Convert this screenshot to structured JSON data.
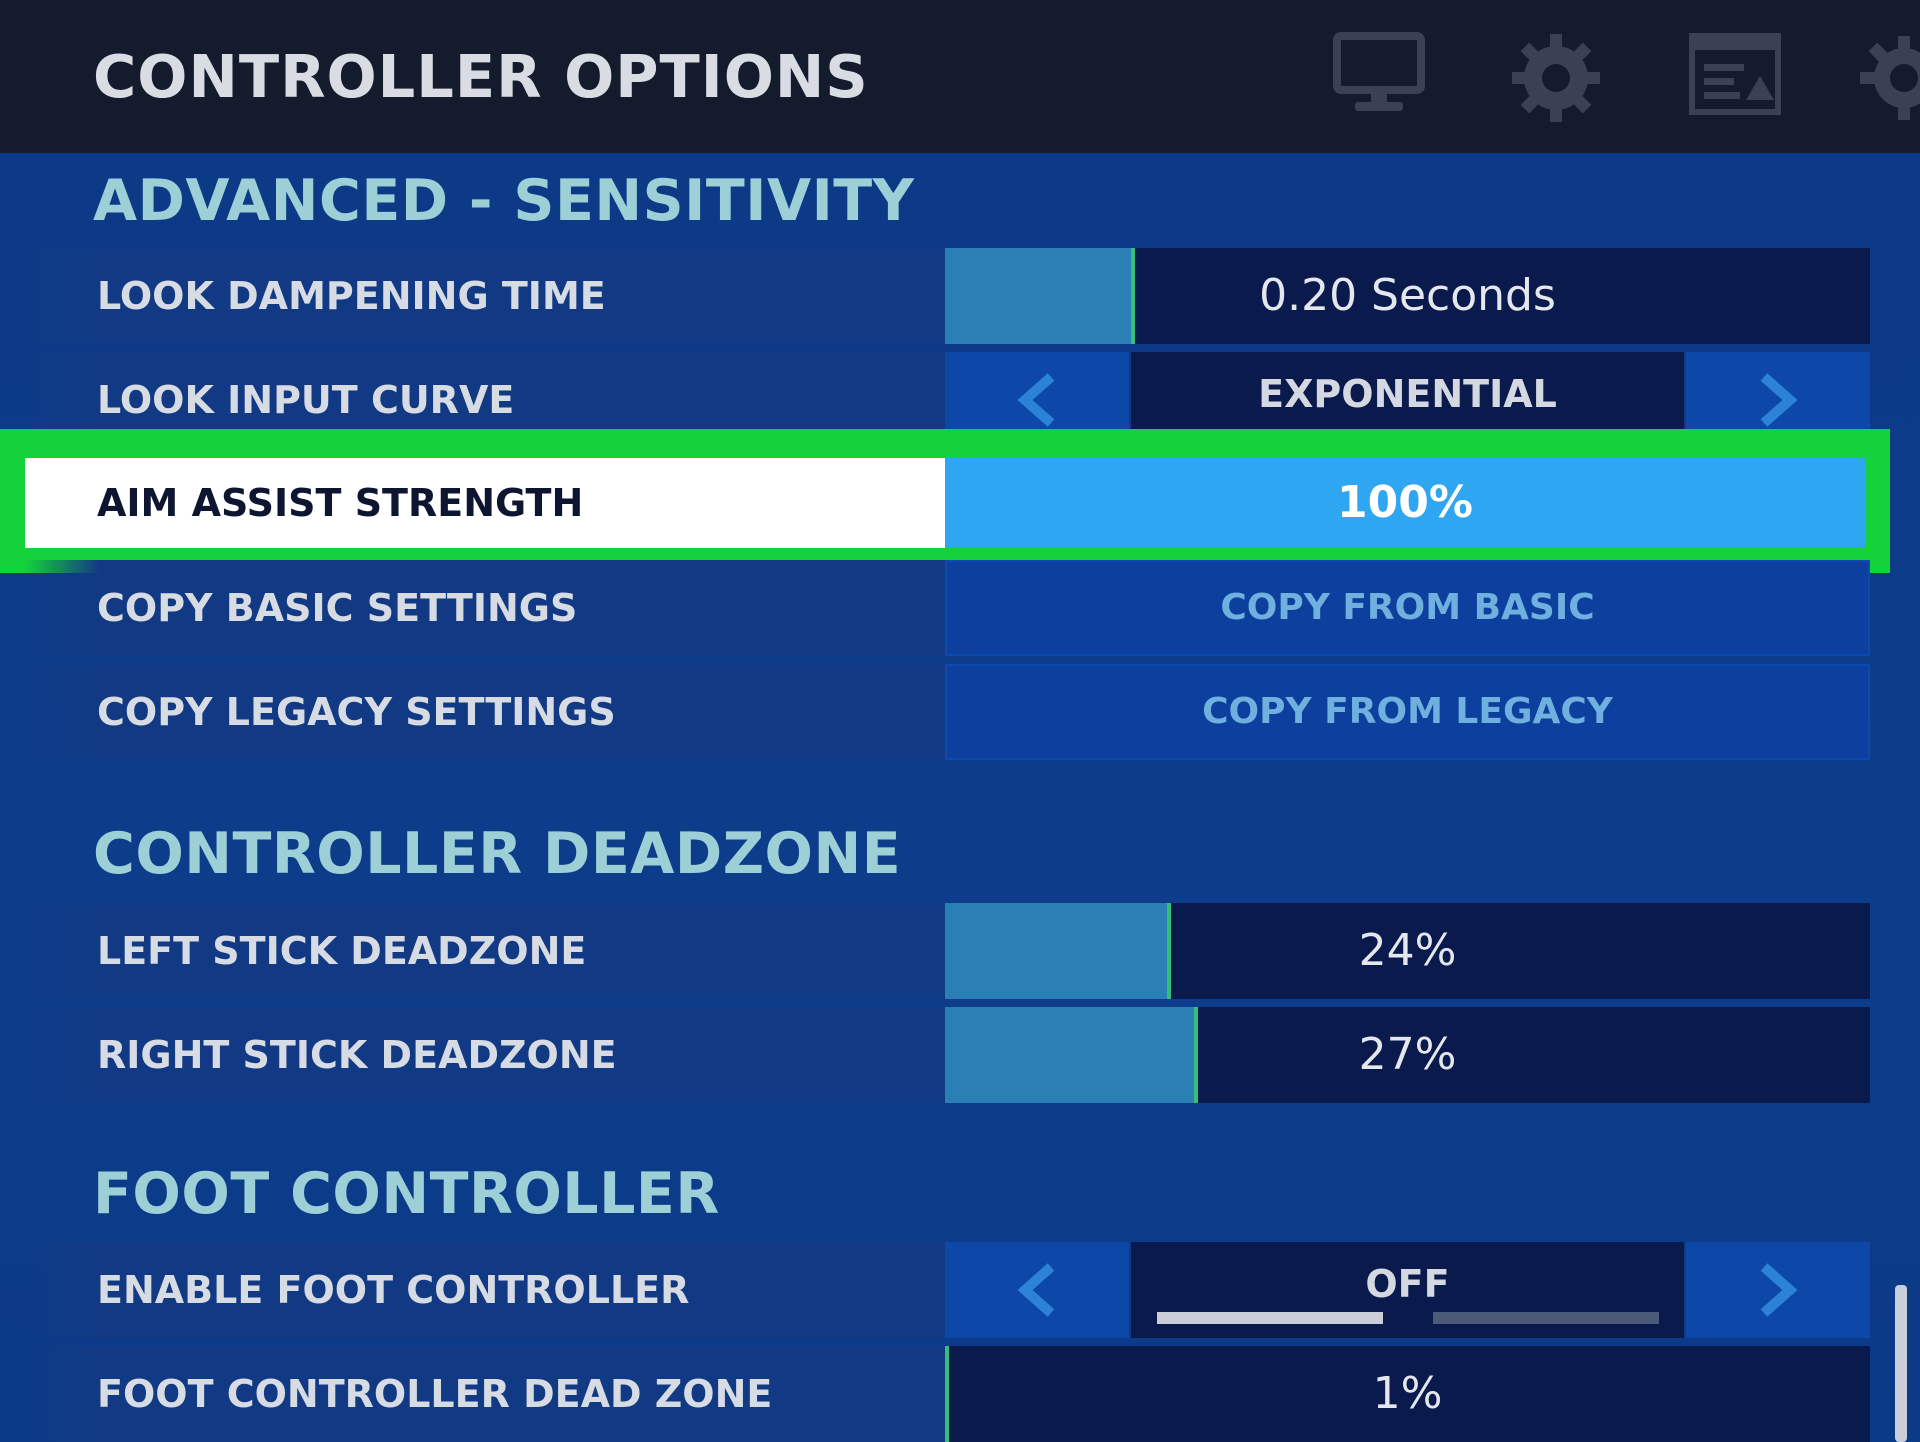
{
  "header": {
    "title": "CONTROLLER OPTIONS",
    "icons": [
      "monitor-icon",
      "gear-icon",
      "hud-layout-icon",
      "gear-refresh-icon"
    ]
  },
  "sections": {
    "sensitivity": {
      "title": "ADVANCED - SENSITIVITY",
      "look_dampening": {
        "label": "LOOK DAMPENING TIME",
        "value": "0.20 Seconds",
        "fill": 0.2
      },
      "look_input_curve": {
        "label": "LOOK INPUT CURVE",
        "value": "EXPONENTIAL"
      },
      "aim_assist": {
        "label": "AIM ASSIST STRENGTH",
        "value": "100%",
        "fill": 1.0
      },
      "copy_basic": {
        "label": "COPY BASIC SETTINGS",
        "button": "COPY FROM BASIC"
      },
      "copy_legacy": {
        "label": "COPY LEGACY SETTINGS",
        "button": "COPY FROM LEGACY"
      }
    },
    "deadzone": {
      "title": "CONTROLLER DEADZONE",
      "left_stick": {
        "label": "LEFT STICK DEADZONE",
        "value": "24%",
        "fill": 0.24
      },
      "right_stick": {
        "label": "RIGHT STICK DEADZONE",
        "value": "27%",
        "fill": 0.27
      }
    },
    "foot": {
      "title": "FOOT CONTROLLER",
      "enable": {
        "label": "ENABLE FOOT CONTROLLER",
        "value": "OFF"
      },
      "dead_zone": {
        "label": "FOOT CONTROLLER DEAD ZONE",
        "value": "1%",
        "fill": 0.01
      }
    }
  },
  "colors": {
    "highlight_frame": "#14d23a",
    "selected_bar": "#2ea6f2",
    "slider_fill": "#2a7fb4",
    "section_title": "#9ccfd6"
  }
}
